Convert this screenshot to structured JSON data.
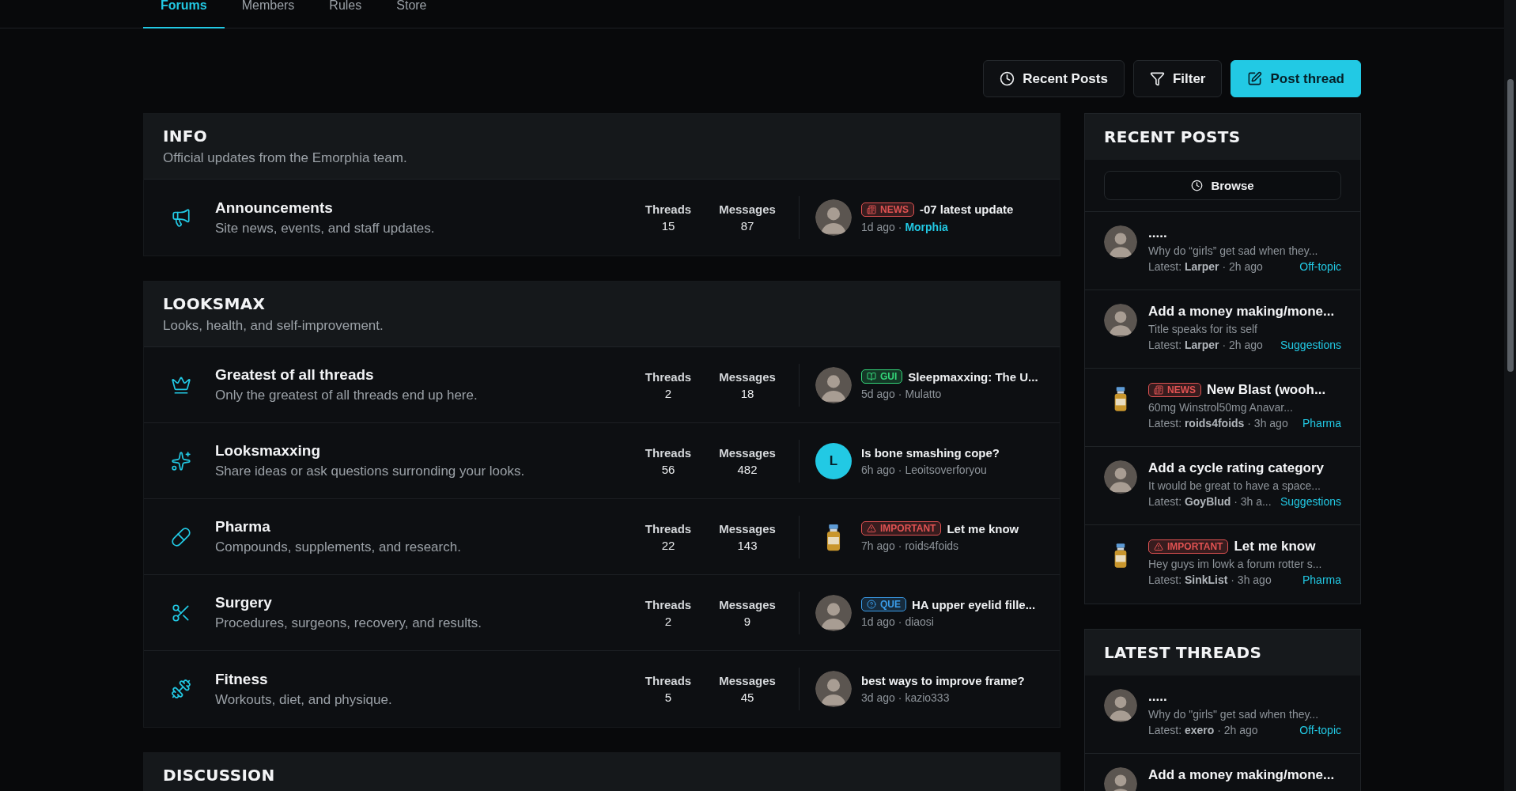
{
  "nav": {
    "tabs": [
      {
        "label": "Forums",
        "selected": true
      },
      {
        "label": "Members",
        "selected": false
      },
      {
        "label": "Rules",
        "selected": false
      },
      {
        "label": "Store",
        "selected": false
      }
    ]
  },
  "actions": [
    {
      "label": "Recent Posts",
      "kind": "recent",
      "primary": false
    },
    {
      "label": "Filter",
      "kind": "filter",
      "primary": false
    },
    {
      "label": "Post thread",
      "kind": "post",
      "primary": true
    }
  ],
  "categories": [
    {
      "title": "INFO",
      "description": "Official updates from the Emorphia team.",
      "forums": [
        {
          "name": "Announcements",
          "description": "Site news, events, and staff updates.",
          "threads_label": "Threads",
          "threads": "15",
          "messages_label": "Messages",
          "messages": "87",
          "last": {
            "avatar": {
              "kind": "photo"
            },
            "tag": {
              "kind": "news",
              "label": "NEWS",
              "color": "#e05252"
            },
            "title": "-07 latest update",
            "time": "1d ago",
            "sep": "·",
            "author": "Morphia",
            "staff": true
          }
        }
      ]
    },
    {
      "title": "LOOKSMAX",
      "description": "Looks, health, and self-improvement.",
      "forums": [
        {
          "name": "Greatest of all threads",
          "description": "Only the greatest of all threads end up here.",
          "threads_label": "Threads",
          "threads": "2",
          "messages_label": "Messages",
          "messages": "18",
          "last": {
            "avatar": {
              "kind": "photo"
            },
            "tag": {
              "kind": "guide",
              "label": "GUI",
              "color": "#34d77a"
            },
            "title": "Sleepmaxxing: The U...",
            "time": "5d ago",
            "sep": "·",
            "author": "Mulatto",
            "staff": false
          }
        },
        {
          "name": "Looksmaxxing",
          "description": "Share ideas or ask questions surronding your looks.",
          "threads_label": "Threads",
          "threads": "56",
          "messages_label": "Messages",
          "messages": "482",
          "last": {
            "avatar": {
              "kind": "letter",
              "letter": "L"
            },
            "title": "Is bone smashing cope?",
            "time": "6h ago",
            "sep": "·",
            "author": "Leoitsoverforyou",
            "staff": false
          }
        },
        {
          "name": "Pharma",
          "description": "Compounds, supplements, and research.",
          "threads_label": "Threads",
          "threads": "22",
          "messages_label": "Messages",
          "messages": "143",
          "last": {
            "avatar": {
              "kind": "vial"
            },
            "tag": {
              "kind": "important",
              "label": "IMPORTANT",
              "color": "#e05252"
            },
            "title": "Let me know",
            "time": "7h ago",
            "sep": "·",
            "author": "roids4foids",
            "staff": false
          }
        },
        {
          "name": "Surgery",
          "description": "Procedures, surgeons, recovery, and results.",
          "threads_label": "Threads",
          "threads": "2",
          "messages_label": "Messages",
          "messages": "9",
          "last": {
            "avatar": {
              "kind": "photo"
            },
            "tag": {
              "kind": "question",
              "label": "QUE",
              "color": "#3b9dea"
            },
            "title": "HA upper eyelid fille...",
            "time": "1d ago",
            "sep": "·",
            "author": "diaosi",
            "staff": false
          }
        },
        {
          "name": "Fitness",
          "description": "Workouts, diet, and physique.",
          "threads_label": "Threads",
          "threads": "5",
          "messages_label": "Messages",
          "messages": "45",
          "last": {
            "avatar": {
              "kind": "photo"
            },
            "title": "best ways to improve frame?",
            "time": "3d ago",
            "sep": "·",
            "author": "kazio333",
            "staff": false
          }
        }
      ]
    },
    {
      "title": "DISCUSSION"
    }
  ],
  "sidebar": [
    {
      "title": "RECENT POSTS",
      "browse": "Browse",
      "posts": [
        {
          "avatar": {
            "kind": "photo"
          },
          "title": ".....",
          "excerpt": "Why do “girls” get sad when they...",
          "prefix": "Latest:",
          "author": "Larper",
          "sep": "·",
          "time": "2h ago",
          "forum": "Off-topic"
        },
        {
          "avatar": {
            "kind": "photo"
          },
          "title": "Add a money making/mone...",
          "excerpt": "Title speaks for its self",
          "prefix": "Latest:",
          "author": "Larper",
          "sep": "·",
          "time": "2h ago",
          "forum": "Suggestions"
        },
        {
          "avatar": {
            "kind": "vial"
          },
          "tag": {
            "kind": "news",
            "label": "NEWS",
            "color": "#e05252"
          },
          "title": "New Blast (wooh...",
          "excerpt": "60mg Winstrol50mg Anavar...",
          "prefix": "Latest:",
          "author": "roids4foids",
          "sep": "·",
          "time": "3h ago",
          "forum": "Pharma"
        },
        {
          "avatar": {
            "kind": "photo"
          },
          "title": "Add a cycle rating category",
          "excerpt": "It would be great to have a space...",
          "prefix": "Latest:",
          "author": "GoyBlud",
          "sep": "·",
          "time": "3h a...",
          "forum": "Suggestions"
        },
        {
          "avatar": {
            "kind": "vial"
          },
          "tag": {
            "kind": "important",
            "label": "IMPORTANT",
            "color": "#e05252"
          },
          "title": "Let me know",
          "excerpt": "Hey guys im lowk a forum rotter s...",
          "prefix": "Latest:",
          "author": "SinkList",
          "sep": "·",
          "time": "3h ago",
          "forum": "Pharma"
        }
      ]
    },
    {
      "title": "LATEST THREADS",
      "posts": [
        {
          "avatar": {
            "kind": "photo"
          },
          "title": ".....",
          "excerpt": "Why do \"girls\" get sad when they...",
          "prefix": "Latest:",
          "author": "exero",
          "sep": "·",
          "time": "2h ago",
          "forum": "Off-topic"
        },
        {
          "avatar": {
            "kind": "photo"
          },
          "title": "Add a money making/mone..."
        }
      ]
    }
  ]
}
